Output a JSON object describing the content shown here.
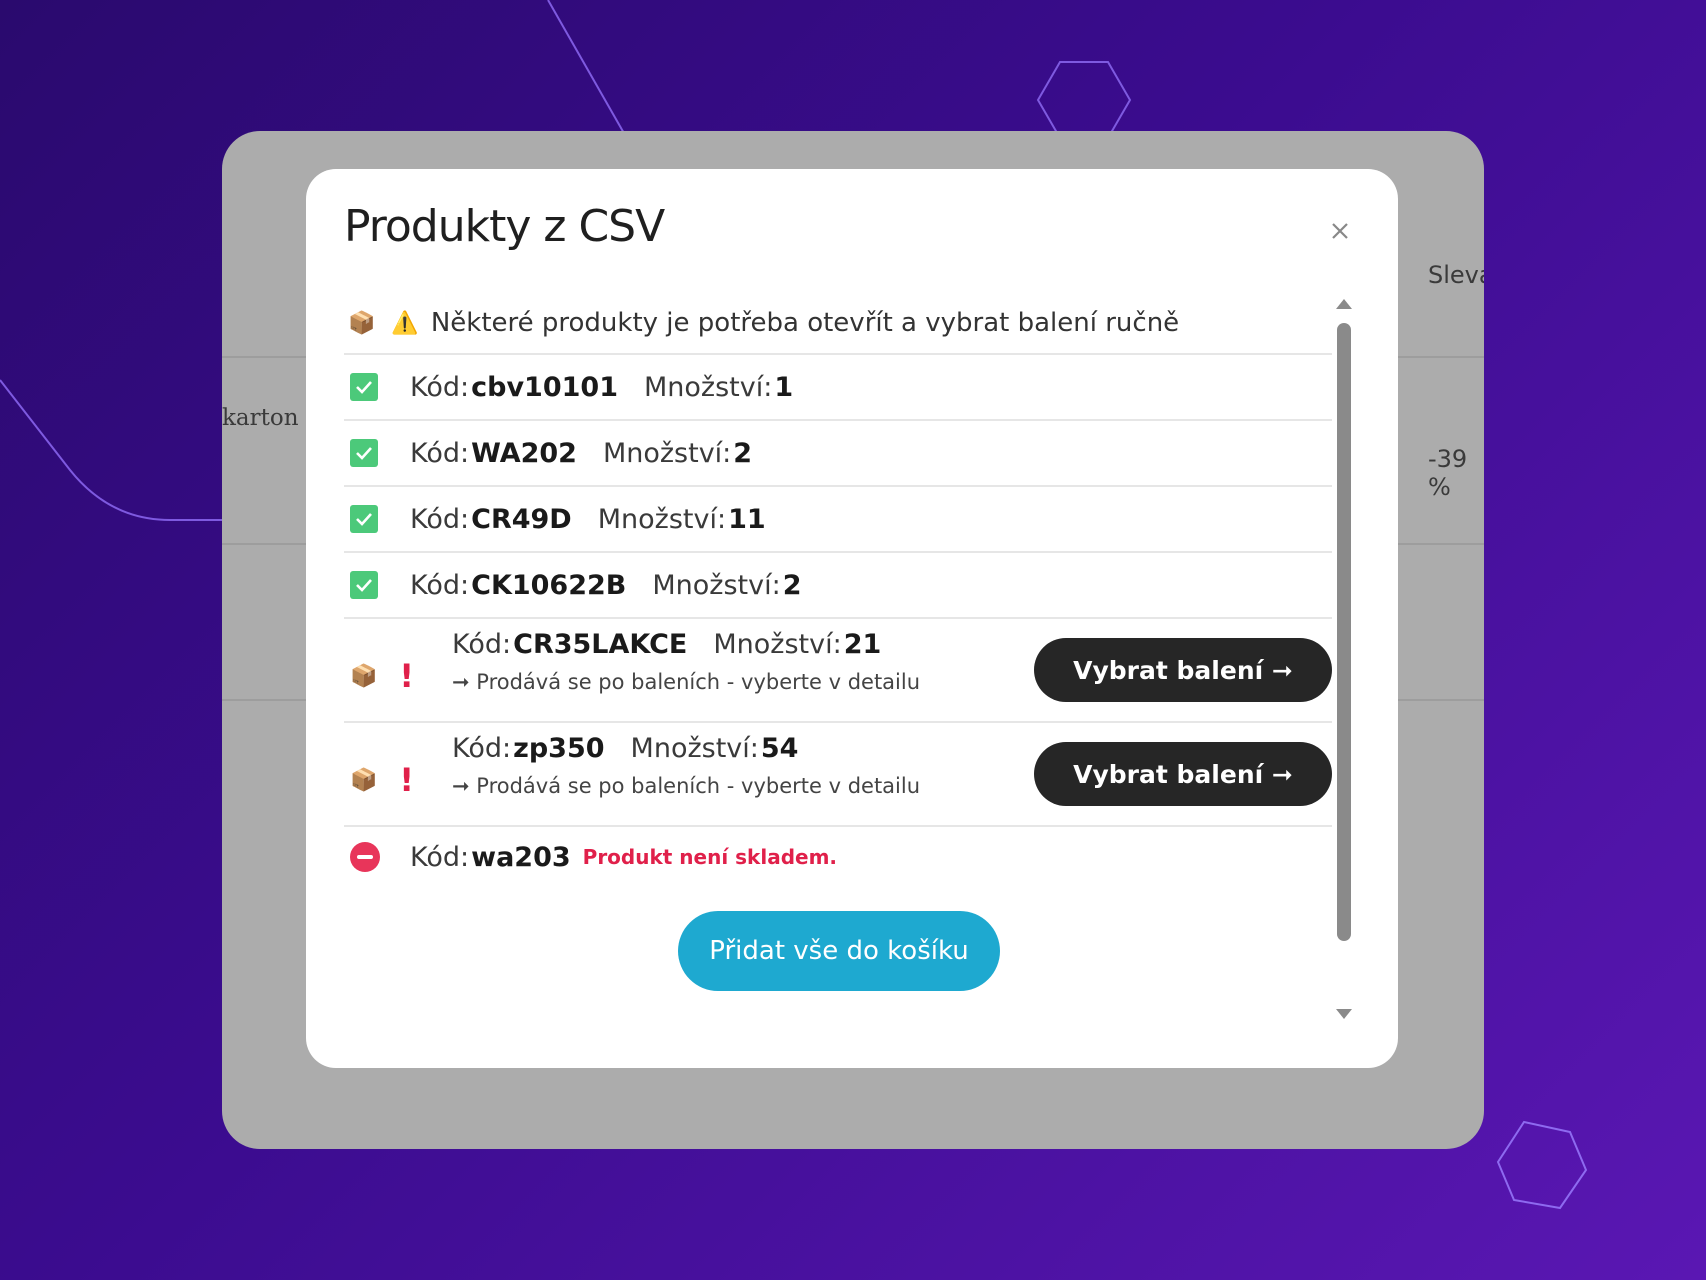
{
  "background_table": {
    "header_discount": "Sleva",
    "cell_left": "karton",
    "cell_discount": "-39 %"
  },
  "modal": {
    "title": "Produkty z CSV",
    "warning_box_icon": "📦",
    "warning_icon": "⚠️",
    "warning_text": "Některé produkty je potřeba otevřít a vybrat balení ručně",
    "code_label": "Kód:",
    "qty_label": "Množství:",
    "ok_items": [
      {
        "code": "cbv10101",
        "qty": "1"
      },
      {
        "code": "WA202",
        "qty": "2"
      },
      {
        "code": "CR49D",
        "qty": "11"
      },
      {
        "code": "CK10622B",
        "qty": "2"
      }
    ],
    "pack_items": [
      {
        "code": "CR35LAKCE",
        "qty": "21",
        "note": "➞ Prodává se po baleních - vyberte v detailu",
        "button": "Vybrat balení ➞"
      },
      {
        "code": "zp350",
        "qty": "54",
        "note": "➞ Prodává se po baleních - vyberte v detailu",
        "button": "Vybrat balení ➞"
      }
    ],
    "error_item": {
      "code": "wa203",
      "message": "Produkt není skladem."
    },
    "add_all_button": "Přidat vše do košíku",
    "box_emoji": "📦",
    "exclaim": "!"
  },
  "colors": {
    "ok": "#4cc97a",
    "error": "#e0204a",
    "primary_button": "#1ea9d0",
    "dark_button": "#262626"
  },
  "icons": [
    "close-icon",
    "check-icon",
    "box-icon",
    "warning-icon",
    "exclamation-icon",
    "no-entry-icon",
    "scroll-up-icon",
    "scroll-down-icon"
  ]
}
